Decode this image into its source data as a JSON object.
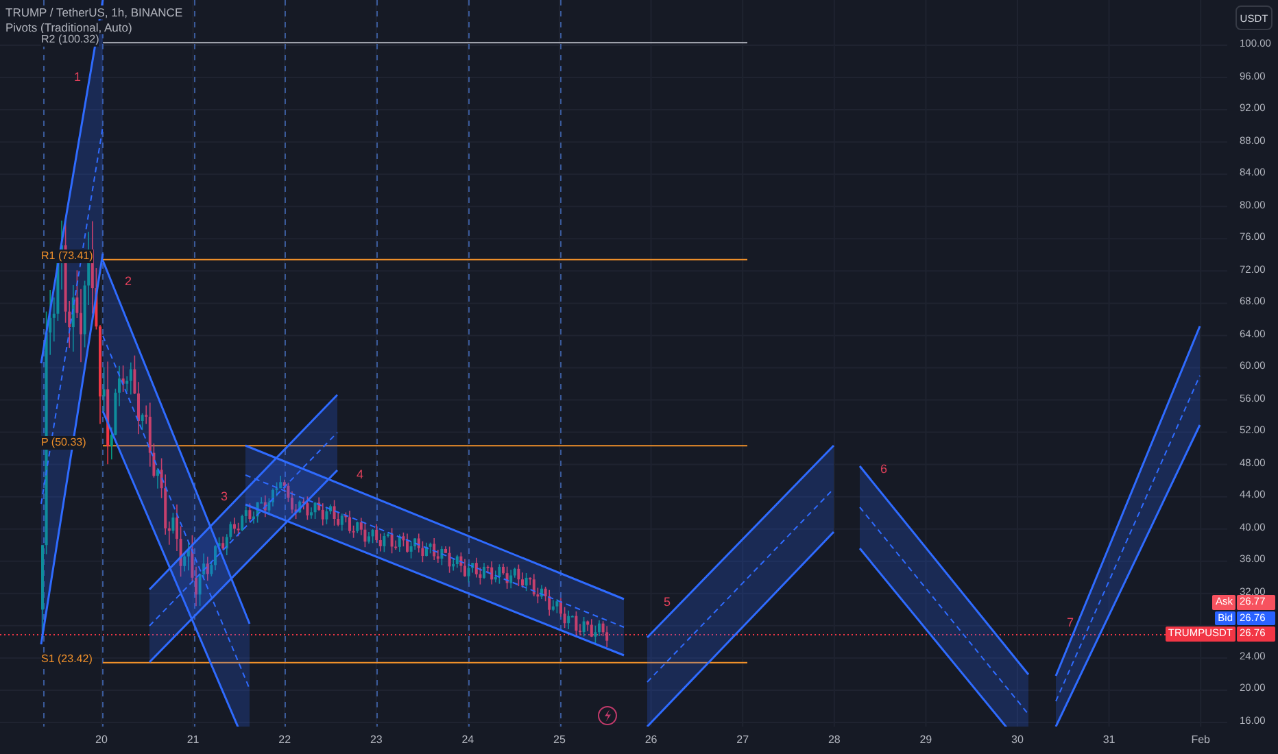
{
  "header": {
    "title": "TRUMP / TetherUS, 1h, BINANCE",
    "indicator": "Pivots (Traditional, Auto)"
  },
  "currency_button": "USDT",
  "price_axis": [
    "100.00",
    "96.00",
    "92.00",
    "88.00",
    "84.00",
    "80.00",
    "76.00",
    "72.00",
    "68.00",
    "64.00",
    "60.00",
    "56.00",
    "52.00",
    "48.00",
    "44.00",
    "40.00",
    "36.00",
    "32.00",
    "24.00",
    "20.00",
    "16.00"
  ],
  "time_axis": [
    "20",
    "21",
    "22",
    "23",
    "24",
    "25",
    "26",
    "27",
    "28",
    "29",
    "30",
    "31",
    "Feb"
  ],
  "pivot_levels": [
    {
      "label": "R2 (100.32)"
    },
    {
      "label": "R1 (73.41)"
    },
    {
      "label": "P (50.33)"
    },
    {
      "label": "S1 (23.42)"
    }
  ],
  "wave_labels": [
    "1",
    "2",
    "3",
    "4",
    "5",
    "6",
    "7"
  ],
  "price_badges": [
    {
      "kind": "ask",
      "label": "Ask",
      "value": "26.77"
    },
    {
      "kind": "bid",
      "label": "Bid",
      "value": "26.76"
    },
    {
      "kind": "last",
      "label": "TRUMPUSDT",
      "value": "26.76"
    }
  ]
}
